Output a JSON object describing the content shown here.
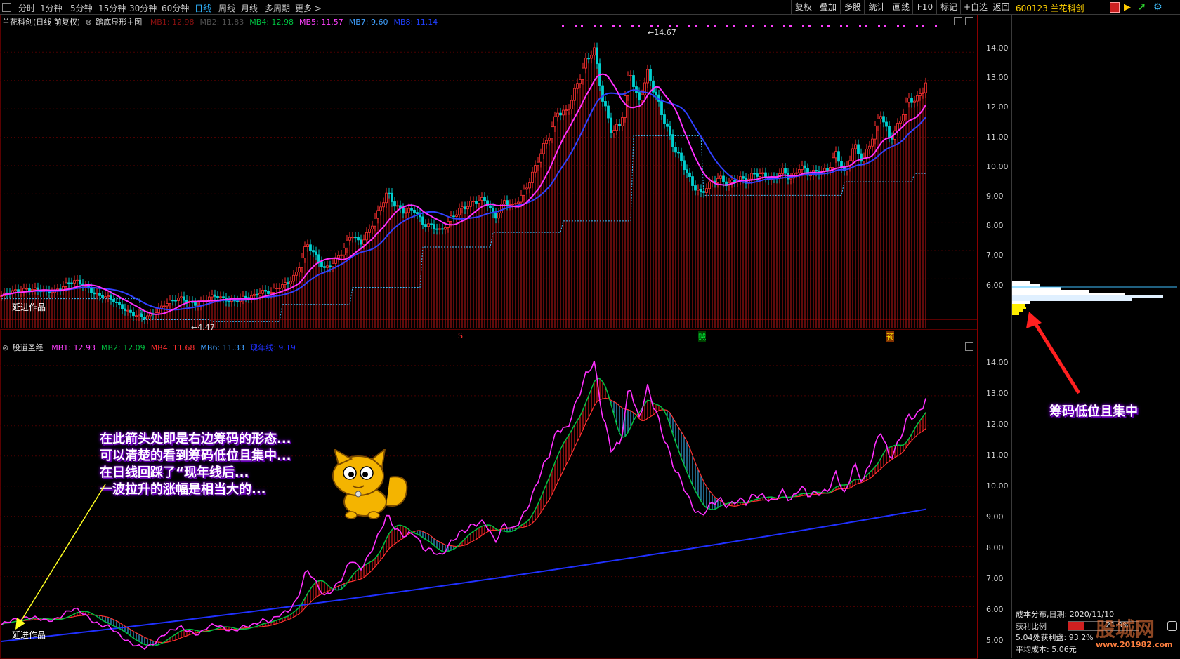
{
  "toolbar": {
    "periods": [
      "分时",
      "1分钟",
      "5分钟",
      "15分钟",
      "30分钟",
      "60分钟",
      "日线",
      "周线",
      "月线",
      "多周期",
      "更多 >"
    ],
    "active_period": "日线",
    "right_buttons": [
      "复权",
      "叠加",
      "多股",
      "统计",
      "画线",
      "F10",
      "标记",
      "+自选",
      "返回"
    ]
  },
  "stock": {
    "code_name": "600123 兰花科创"
  },
  "main_panel": {
    "title": "兰花科创(日线 前复权)",
    "indicator_name": "踏底显形主图",
    "legend": [
      {
        "label": "MB1: 12.98",
        "color": "#8a1010"
      },
      {
        "label": "MB2: 11.83",
        "color": "#505050"
      },
      {
        "label": "MB4: 12.98",
        "color": "#00c040"
      },
      {
        "label": "MB5: 11.57",
        "color": "#ff40ff"
      },
      {
        "label": "MB7: 9.60",
        "color": "#40a0ff"
      },
      {
        "label": "MB8: 11.14",
        "color": "#2040ff"
      }
    ],
    "yticks": [
      "14.00",
      "13.00",
      "12.00",
      "11.00",
      "10.00",
      "9.00",
      "8.00",
      "7.00",
      "6.00"
    ],
    "high_label": "14.67",
    "low_label": "4.47",
    "watermark": "延进作品",
    "bottom_markers": [
      "S",
      "贼",
      "预"
    ]
  },
  "sub_panel": {
    "indicator_name": "股道圣经",
    "legend": [
      {
        "label": "MB1: 12.93",
        "color": "#ff40ff"
      },
      {
        "label": "MB2: 12.09",
        "color": "#00c040"
      },
      {
        "label": "MB4: 11.68",
        "color": "#ff3030"
      },
      {
        "label": "MB6: 11.33",
        "color": "#40a0ff"
      },
      {
        "label": "现年线: 9.19",
        "color": "#2030ff"
      }
    ],
    "yticks": [
      "14.00",
      "13.00",
      "12.00",
      "11.00",
      "10.00",
      "9.00",
      "8.00",
      "7.00",
      "6.00",
      "5.00"
    ],
    "watermark": "延进作品"
  },
  "annotations": {
    "left_note": [
      "在此箭头处即是右边筹码的形态...",
      "可以清楚的看到筹码低位且集中...",
      "在日线回踩了“现年线后...",
      "一波拉升的涨幅是相当大的..."
    ],
    "right_note": "筹码低位且集中"
  },
  "chip_panel": {
    "title": "成本分布,日期: 2020/11/10",
    "profit_ratio_label": "获利比例",
    "profit_ratio_value": "21.9%",
    "price_row": "5.04处获利盘: 93.2%",
    "avg_cost": "平均成本: 5.06元",
    "site_watermark": "www.201982.com",
    "logo_text": "股城网"
  },
  "colors": {
    "candle_up": "#ff3030",
    "candle_down": "#00d0d0",
    "ma_fast": "#ff30ff",
    "ma_slow": "#3040ff",
    "support": "#40c0ff",
    "volume": "#8a1010",
    "grid": "#4a0000",
    "axis": "#8a0000"
  },
  "chart_data": {
    "type": "line",
    "price_range": [
      4.47,
      14.67
    ],
    "sub_line_range": [
      4.5,
      14.3
    ],
    "price_series": [
      5.4,
      5.5,
      5.6,
      5.7,
      5.6,
      5.5,
      5.6,
      5.8,
      5.9,
      5.8,
      5.6,
      5.4,
      5.3,
      5.1,
      4.9,
      4.7,
      4.6,
      4.8,
      5.1,
      5.2,
      5.3,
      5.2,
      5.1,
      5.3,
      5.4,
      5.3,
      5.2,
      5.3,
      5.4,
      5.6,
      5.5,
      5.7,
      5.9,
      6.3,
      7.2,
      6.8,
      6.4,
      6.6,
      6.9,
      7.6,
      7.3,
      7.7,
      8.3,
      9.1,
      8.6,
      8.3,
      8.4,
      8.0,
      7.9,
      7.6,
      8.1,
      8.5,
      8.6,
      8.7,
      8.8,
      8.2,
      8.7,
      8.5,
      9.0,
      9.6,
      10.3,
      11.0,
      12.0,
      11.9,
      12.6,
      13.6,
      14.3,
      12.3,
      11.1,
      11.5,
      13.5,
      12.1,
      13.2,
      12.5,
      11.5,
      10.5,
      10.0,
      9.4,
      9.0,
      9.3,
      9.6,
      9.4,
      9.5,
      9.4,
      9.8,
      9.7,
      9.4,
      9.8,
      9.6,
      10.0,
      9.6,
      9.8,
      9.9,
      10.4,
      9.6,
      10.8,
      10.2,
      10.9,
      11.8,
      11.0,
      11.5,
      12.2,
      12.3,
      13.0
    ]
  }
}
